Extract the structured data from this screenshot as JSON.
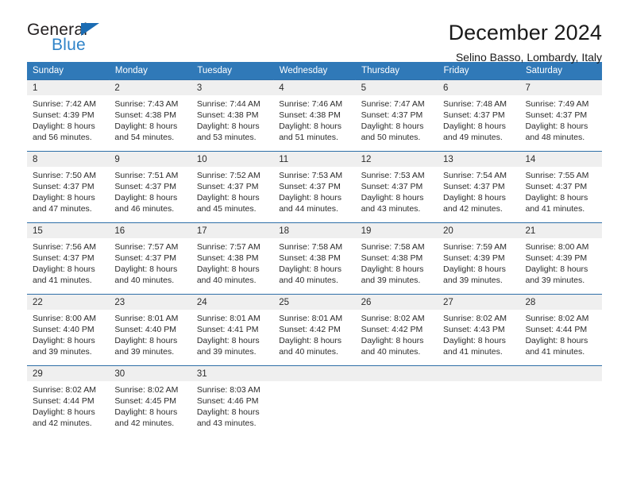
{
  "brand": {
    "name_dark": "General",
    "name_blue": "Blue",
    "triangle_color": "#1b6cb3",
    "blue_text_color": "#2f83c8"
  },
  "header": {
    "title": "December 2024",
    "subtitle": "Selino Basso, Lombardy, Italy"
  },
  "theme": {
    "header_bg": "#3079b8",
    "header_text": "#ffffff",
    "daynum_bg": "#efefef",
    "row_border": "#2f6fa8"
  },
  "labels": {
    "sunrise_prefix": "Sunrise:",
    "sunset_prefix": "Sunset:",
    "daylight_prefix": "Daylight:"
  },
  "weekdays": [
    "Sunday",
    "Monday",
    "Tuesday",
    "Wednesday",
    "Thursday",
    "Friday",
    "Saturday"
  ],
  "weeks": [
    [
      {
        "day": "1",
        "sunrise": "Sunrise: 7:42 AM",
        "sunset": "Sunset: 4:39 PM",
        "daylight_line1": "Daylight: 8 hours",
        "daylight_line2": "and 56 minutes."
      },
      {
        "day": "2",
        "sunrise": "Sunrise: 7:43 AM",
        "sunset": "Sunset: 4:38 PM",
        "daylight_line1": "Daylight: 8 hours",
        "daylight_line2": "and 54 minutes."
      },
      {
        "day": "3",
        "sunrise": "Sunrise: 7:44 AM",
        "sunset": "Sunset: 4:38 PM",
        "daylight_line1": "Daylight: 8 hours",
        "daylight_line2": "and 53 minutes."
      },
      {
        "day": "4",
        "sunrise": "Sunrise: 7:46 AM",
        "sunset": "Sunset: 4:38 PM",
        "daylight_line1": "Daylight: 8 hours",
        "daylight_line2": "and 51 minutes."
      },
      {
        "day": "5",
        "sunrise": "Sunrise: 7:47 AM",
        "sunset": "Sunset: 4:37 PM",
        "daylight_line1": "Daylight: 8 hours",
        "daylight_line2": "and 50 minutes."
      },
      {
        "day": "6",
        "sunrise": "Sunrise: 7:48 AM",
        "sunset": "Sunset: 4:37 PM",
        "daylight_line1": "Daylight: 8 hours",
        "daylight_line2": "and 49 minutes."
      },
      {
        "day": "7",
        "sunrise": "Sunrise: 7:49 AM",
        "sunset": "Sunset: 4:37 PM",
        "daylight_line1": "Daylight: 8 hours",
        "daylight_line2": "and 48 minutes."
      }
    ],
    [
      {
        "day": "8",
        "sunrise": "Sunrise: 7:50 AM",
        "sunset": "Sunset: 4:37 PM",
        "daylight_line1": "Daylight: 8 hours",
        "daylight_line2": "and 47 minutes."
      },
      {
        "day": "9",
        "sunrise": "Sunrise: 7:51 AM",
        "sunset": "Sunset: 4:37 PM",
        "daylight_line1": "Daylight: 8 hours",
        "daylight_line2": "and 46 minutes."
      },
      {
        "day": "10",
        "sunrise": "Sunrise: 7:52 AM",
        "sunset": "Sunset: 4:37 PM",
        "daylight_line1": "Daylight: 8 hours",
        "daylight_line2": "and 45 minutes."
      },
      {
        "day": "11",
        "sunrise": "Sunrise: 7:53 AM",
        "sunset": "Sunset: 4:37 PM",
        "daylight_line1": "Daylight: 8 hours",
        "daylight_line2": "and 44 minutes."
      },
      {
        "day": "12",
        "sunrise": "Sunrise: 7:53 AM",
        "sunset": "Sunset: 4:37 PM",
        "daylight_line1": "Daylight: 8 hours",
        "daylight_line2": "and 43 minutes."
      },
      {
        "day": "13",
        "sunrise": "Sunrise: 7:54 AM",
        "sunset": "Sunset: 4:37 PM",
        "daylight_line1": "Daylight: 8 hours",
        "daylight_line2": "and 42 minutes."
      },
      {
        "day": "14",
        "sunrise": "Sunrise: 7:55 AM",
        "sunset": "Sunset: 4:37 PM",
        "daylight_line1": "Daylight: 8 hours",
        "daylight_line2": "and 41 minutes."
      }
    ],
    [
      {
        "day": "15",
        "sunrise": "Sunrise: 7:56 AM",
        "sunset": "Sunset: 4:37 PM",
        "daylight_line1": "Daylight: 8 hours",
        "daylight_line2": "and 41 minutes."
      },
      {
        "day": "16",
        "sunrise": "Sunrise: 7:57 AM",
        "sunset": "Sunset: 4:37 PM",
        "daylight_line1": "Daylight: 8 hours",
        "daylight_line2": "and 40 minutes."
      },
      {
        "day": "17",
        "sunrise": "Sunrise: 7:57 AM",
        "sunset": "Sunset: 4:38 PM",
        "daylight_line1": "Daylight: 8 hours",
        "daylight_line2": "and 40 minutes."
      },
      {
        "day": "18",
        "sunrise": "Sunrise: 7:58 AM",
        "sunset": "Sunset: 4:38 PM",
        "daylight_line1": "Daylight: 8 hours",
        "daylight_line2": "and 40 minutes."
      },
      {
        "day": "19",
        "sunrise": "Sunrise: 7:58 AM",
        "sunset": "Sunset: 4:38 PM",
        "daylight_line1": "Daylight: 8 hours",
        "daylight_line2": "and 39 minutes."
      },
      {
        "day": "20",
        "sunrise": "Sunrise: 7:59 AM",
        "sunset": "Sunset: 4:39 PM",
        "daylight_line1": "Daylight: 8 hours",
        "daylight_line2": "and 39 minutes."
      },
      {
        "day": "21",
        "sunrise": "Sunrise: 8:00 AM",
        "sunset": "Sunset: 4:39 PM",
        "daylight_line1": "Daylight: 8 hours",
        "daylight_line2": "and 39 minutes."
      }
    ],
    [
      {
        "day": "22",
        "sunrise": "Sunrise: 8:00 AM",
        "sunset": "Sunset: 4:40 PM",
        "daylight_line1": "Daylight: 8 hours",
        "daylight_line2": "and 39 minutes."
      },
      {
        "day": "23",
        "sunrise": "Sunrise: 8:01 AM",
        "sunset": "Sunset: 4:40 PM",
        "daylight_line1": "Daylight: 8 hours",
        "daylight_line2": "and 39 minutes."
      },
      {
        "day": "24",
        "sunrise": "Sunrise: 8:01 AM",
        "sunset": "Sunset: 4:41 PM",
        "daylight_line1": "Daylight: 8 hours",
        "daylight_line2": "and 39 minutes."
      },
      {
        "day": "25",
        "sunrise": "Sunrise: 8:01 AM",
        "sunset": "Sunset: 4:42 PM",
        "daylight_line1": "Daylight: 8 hours",
        "daylight_line2": "and 40 minutes."
      },
      {
        "day": "26",
        "sunrise": "Sunrise: 8:02 AM",
        "sunset": "Sunset: 4:42 PM",
        "daylight_line1": "Daylight: 8 hours",
        "daylight_line2": "and 40 minutes."
      },
      {
        "day": "27",
        "sunrise": "Sunrise: 8:02 AM",
        "sunset": "Sunset: 4:43 PM",
        "daylight_line1": "Daylight: 8 hours",
        "daylight_line2": "and 41 minutes."
      },
      {
        "day": "28",
        "sunrise": "Sunrise: 8:02 AM",
        "sunset": "Sunset: 4:44 PM",
        "daylight_line1": "Daylight: 8 hours",
        "daylight_line2": "and 41 minutes."
      }
    ],
    [
      {
        "day": "29",
        "sunrise": "Sunrise: 8:02 AM",
        "sunset": "Sunset: 4:44 PM",
        "daylight_line1": "Daylight: 8 hours",
        "daylight_line2": "and 42 minutes."
      },
      {
        "day": "30",
        "sunrise": "Sunrise: 8:02 AM",
        "sunset": "Sunset: 4:45 PM",
        "daylight_line1": "Daylight: 8 hours",
        "daylight_line2": "and 42 minutes."
      },
      {
        "day": "31",
        "sunrise": "Sunrise: 8:03 AM",
        "sunset": "Sunset: 4:46 PM",
        "daylight_line1": "Daylight: 8 hours",
        "daylight_line2": "and 43 minutes."
      },
      {
        "day": "",
        "sunrise": "",
        "sunset": "",
        "daylight_line1": "",
        "daylight_line2": ""
      },
      {
        "day": "",
        "sunrise": "",
        "sunset": "",
        "daylight_line1": "",
        "daylight_line2": ""
      },
      {
        "day": "",
        "sunrise": "",
        "sunset": "",
        "daylight_line1": "",
        "daylight_line2": ""
      },
      {
        "day": "",
        "sunrise": "",
        "sunset": "",
        "daylight_line1": "",
        "daylight_line2": ""
      }
    ]
  ]
}
